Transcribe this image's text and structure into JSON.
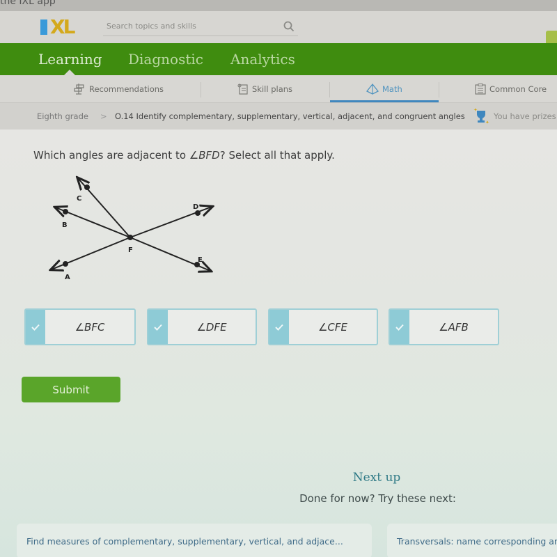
{
  "app": {
    "title": "the IXL app"
  },
  "header": {
    "logo_text": "IXL",
    "search": {
      "placeholder": "Search topics and skills",
      "value": ""
    }
  },
  "main_nav": {
    "items": [
      {
        "label": "Learning",
        "active": true
      },
      {
        "label": "Diagnostic",
        "active": false
      },
      {
        "label": "Analytics",
        "active": false
      }
    ]
  },
  "sub_nav": {
    "items": [
      {
        "label": "Recommendations",
        "icon": "signpost-icon",
        "active": false
      },
      {
        "label": "Skill plans",
        "icon": "clipboard-icon",
        "active": false
      },
      {
        "label": "Math",
        "icon": "pyramid-icon",
        "active": true
      },
      {
        "label": "Common Core",
        "icon": "list-icon",
        "active": false
      }
    ]
  },
  "breadcrumb": {
    "grade": "Eighth grade",
    "separator": ">",
    "skill": "O.14 Identify complementary, supplementary, vertical, adjacent, and congruent angles",
    "prizes": "You have prizes"
  },
  "question": {
    "prefix": "Which angles are adjacent to ",
    "angle": "∠BFD",
    "suffix": "? Select all that apply."
  },
  "diagram": {
    "points": [
      "A",
      "B",
      "C",
      "D",
      "E",
      "F"
    ],
    "vertex": "F",
    "lines": [
      "A-F-D",
      "B-F-E"
    ],
    "ray": "F-C"
  },
  "choices": [
    {
      "label": "∠BFC",
      "checked": false
    },
    {
      "label": "∠DFE",
      "checked": false
    },
    {
      "label": "∠CFE",
      "checked": false
    },
    {
      "label": "∠AFB",
      "checked": false
    }
  ],
  "submit_label": "Submit",
  "next_up": {
    "title": "Next up",
    "subtitle": "Done for now? Try these next:",
    "recommendations": [
      "Find measures of complementary, supplementary, vertical, and adjace...",
      "Transversals: name corresponding angles"
    ]
  },
  "colors": {
    "brand_green": "#3f8c0f",
    "submit_green": "#5aa52a",
    "choice_teal": "#8ecbd6",
    "active_blue": "#3f87be"
  }
}
